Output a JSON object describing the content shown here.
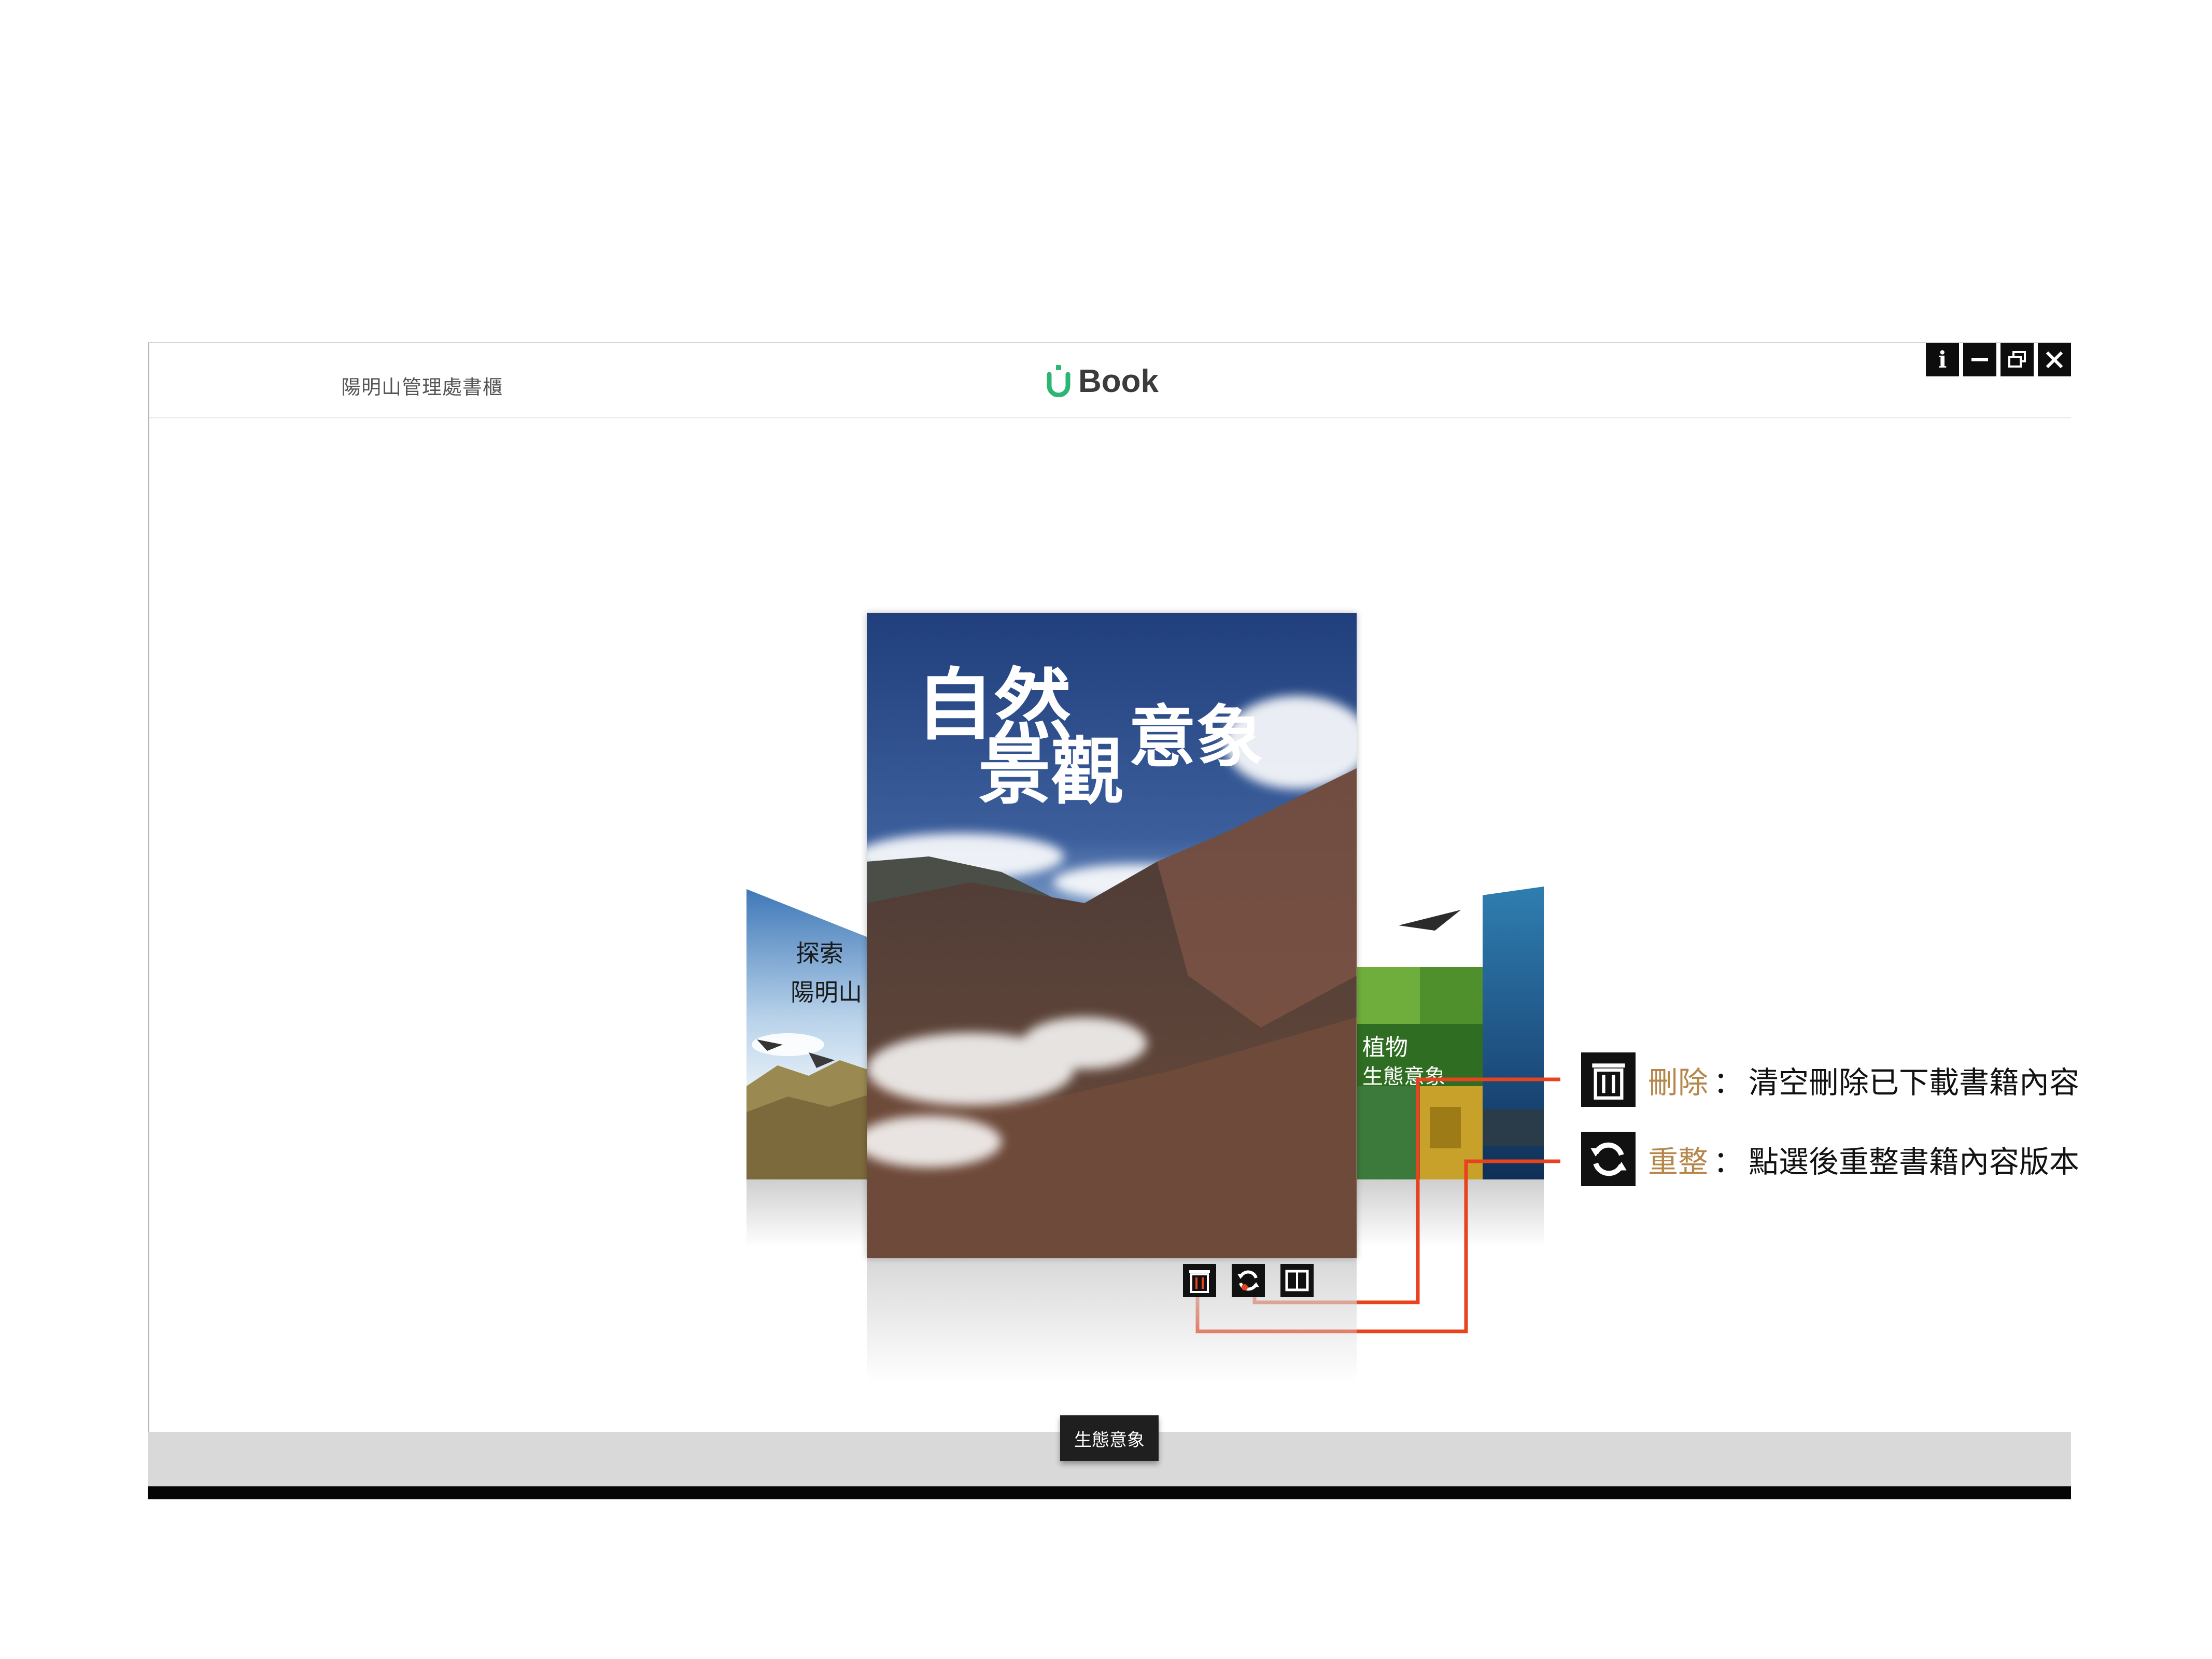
{
  "window": {
    "shelf_title": "陽明山管理處書櫃",
    "logo_text": "Book",
    "controls": [
      {
        "name": "info",
        "glyph": "i"
      },
      {
        "name": "minimize",
        "glyph": "—"
      },
      {
        "name": "restore",
        "glyph": "restore-icon"
      },
      {
        "name": "close",
        "glyph": "✕"
      }
    ]
  },
  "books": {
    "selected_title": "生態意象",
    "main_cover_title": [
      "自然",
      "景觀",
      "意象"
    ],
    "left_cover_title": [
      "探索",
      "陽明山"
    ],
    "right_cover_title": [
      "植物",
      "生態意象"
    ],
    "actions": [
      {
        "name": "delete",
        "icon": "trash-icon"
      },
      {
        "name": "refresh",
        "icon": "refresh-icon"
      },
      {
        "name": "read",
        "icon": "book-icon"
      }
    ]
  },
  "annotations": [
    {
      "label": "刪除",
      "colon": "：",
      "description": "清空刪除已下載書籍內容",
      "icon": "trash-icon"
    },
    {
      "label": "重整",
      "colon": "：",
      "description": "點選後重整書籍內容版本",
      "icon": "refresh-icon"
    }
  ],
  "colors": {
    "accent_label": "#b5874a",
    "leader_line": "#e8431f",
    "logo_green": "#2bb673"
  }
}
